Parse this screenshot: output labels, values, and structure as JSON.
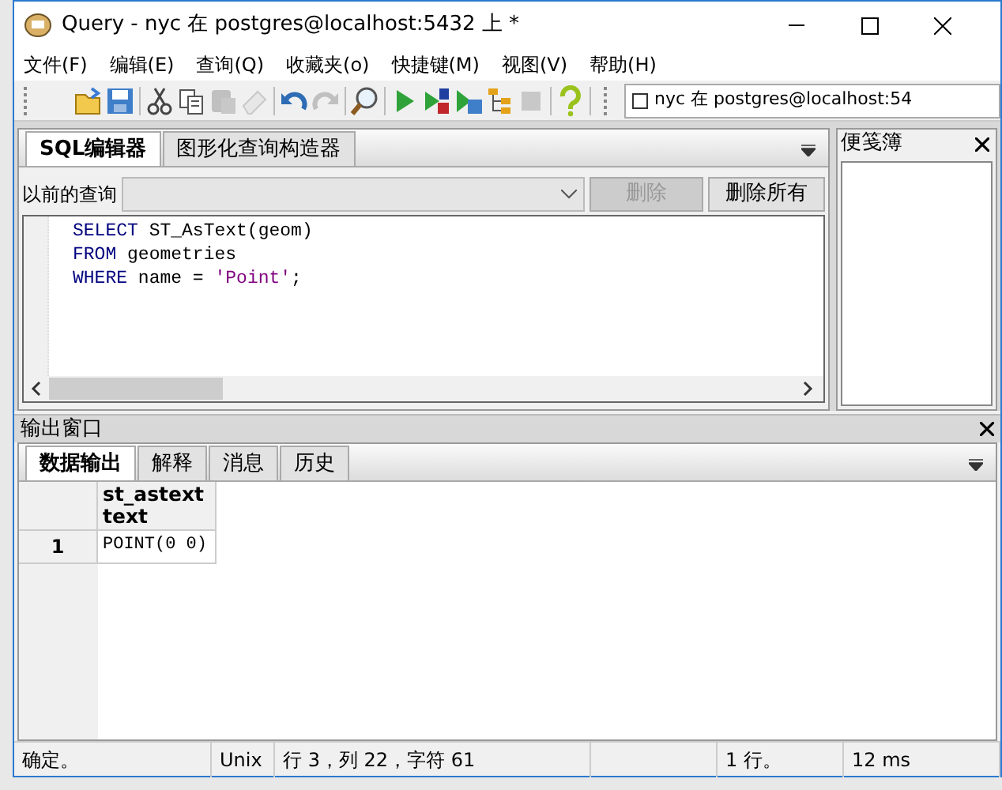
{
  "window": {
    "title": "Query - nyc 在  postgres@localhost:5432 上 *"
  },
  "menu": [
    "文件(F)",
    "编辑(E)",
    "查询(Q)",
    "收藏夹(o)",
    "快捷键(M)",
    "视图(V)",
    "帮助(H)"
  ],
  "toolbar": [
    {
      "kind": "open",
      "disabled": false
    },
    {
      "kind": "save",
      "disabled": false
    },
    {
      "kind": "sep"
    },
    {
      "kind": "cut",
      "disabled": false
    },
    {
      "kind": "copy",
      "disabled": false
    },
    {
      "kind": "paste",
      "disabled": true
    },
    {
      "kind": "eraser",
      "disabled": true
    },
    {
      "kind": "sep"
    },
    {
      "kind": "undo",
      "disabled": false
    },
    {
      "kind": "redo",
      "disabled": true
    },
    {
      "kind": "sep"
    },
    {
      "kind": "find",
      "disabled": false
    },
    {
      "kind": "sep"
    },
    {
      "kind": "run",
      "disabled": false
    },
    {
      "kind": "runscript",
      "disabled": false
    },
    {
      "kind": "runfile",
      "disabled": false
    },
    {
      "kind": "explain",
      "disabled": false
    },
    {
      "kind": "stop",
      "disabled": true
    },
    {
      "kind": "sep"
    },
    {
      "kind": "help",
      "disabled": false
    }
  ],
  "connection": {
    "checked": false,
    "label": "nyc 在  postgres@localhost:54"
  },
  "editor_tabs": [
    {
      "label": "SQL编辑器",
      "selected": true
    },
    {
      "label": "图形化查询构造器",
      "selected": false
    }
  ],
  "history": {
    "label": "以前的查询",
    "buttons": [
      {
        "label": "删除",
        "disabled": true
      },
      {
        "label": "删除所有",
        "disabled": false
      }
    ]
  },
  "code": [
    [
      {
        "kind": "keyword",
        "text": "SELECT"
      },
      {
        "kind": "plain",
        "text": " ST_AsText(geom)"
      }
    ],
    [
      {
        "kind": "keyword",
        "text": "FROM"
      },
      {
        "kind": "plain",
        "text": " geometries"
      }
    ],
    [
      {
        "kind": "keyword",
        "text": "WHERE"
      },
      {
        "kind": "plain",
        "text": " name = "
      },
      {
        "kind": "string",
        "text": "'Point'"
      },
      {
        "kind": "plain",
        "text": ";"
      }
    ]
  ],
  "scratch_pad": {
    "title": "便笺簿"
  },
  "output": {
    "title": "输出窗口",
    "tabs": [
      {
        "label": "数据输出",
        "selected": true
      },
      {
        "label": "解释",
        "selected": false
      },
      {
        "label": "消息",
        "selected": false
      },
      {
        "label": "历史",
        "selected": false
      }
    ],
    "columns": [
      {
        "name": "st_astext",
        "type": "text"
      }
    ],
    "rows": [
      {
        "number": "1",
        "cells": [
          "POINT(0 0)"
        ]
      }
    ]
  },
  "status_bar": [
    "确定。",
    "Unix",
    "行 3，列 22，字符 61",
    "1 行。",
    "12 ms"
  ]
}
